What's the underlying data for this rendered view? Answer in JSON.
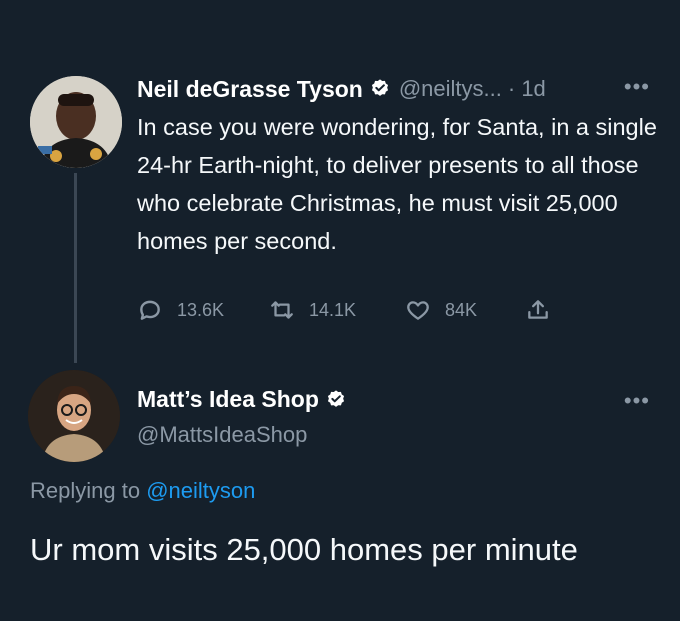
{
  "colors": {
    "background": "#15202b",
    "primary_text": "#f5f8fa",
    "secondary_text": "#8b98a5",
    "accent": "#1d9bf0"
  },
  "tweet_1": {
    "author_name": "Neil deGrasse Tyson",
    "handle": "@neiltys...",
    "time": "· 1d",
    "more_icon": "•••",
    "text": "In case you were wondering, for Santa, in a single 24-hr Earth-night, to deliver presents to all those who celebrate Christmas, he must visit 25,000 homes per second.",
    "actions": {
      "replies": "13.6K",
      "retweets": "14.1K",
      "likes": "84K"
    }
  },
  "tweet_2": {
    "author_name": "Matt’s Idea Shop",
    "handle": "@MattsIdeaShop",
    "more_icon": "•••",
    "replying_prefix": "Replying to ",
    "replying_mention": "@neiltyson",
    "text": "Ur mom visits 25,000 homes per minute"
  }
}
